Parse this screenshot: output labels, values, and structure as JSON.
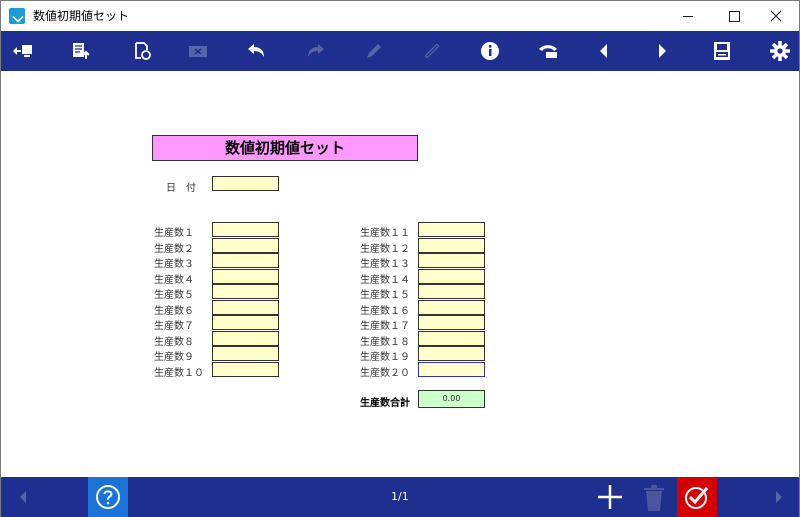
{
  "window": {
    "title": "数値初期値セット"
  },
  "toolbar": {
    "buttons": [
      {
        "name": "exit-icon",
        "enabled": true
      },
      {
        "name": "document-upload-icon",
        "enabled": true
      },
      {
        "name": "document-refresh-icon",
        "enabled": true
      },
      {
        "name": "clear-icon",
        "enabled": false
      },
      {
        "name": "undo-icon",
        "enabled": true
      },
      {
        "name": "redo-icon",
        "enabled": false
      },
      {
        "name": "pen-icon",
        "enabled": false
      },
      {
        "name": "link-icon",
        "enabled": false
      },
      {
        "name": "info-icon",
        "enabled": true
      },
      {
        "name": "phone-icon",
        "enabled": true
      },
      {
        "name": "prev-icon",
        "enabled": true
      },
      {
        "name": "next-icon",
        "enabled": true
      },
      {
        "name": "print-icon",
        "enabled": true
      },
      {
        "name": "gear-icon",
        "enabled": true
      }
    ]
  },
  "form": {
    "title": "数値初期値セット",
    "date_label": "日　付",
    "date_value": "",
    "left_fields": [
      {
        "label": "生産数１",
        "value": ""
      },
      {
        "label": "生産数２",
        "value": ""
      },
      {
        "label": "生産数３",
        "value": ""
      },
      {
        "label": "生産数４",
        "value": ""
      },
      {
        "label": "生産数５",
        "value": ""
      },
      {
        "label": "生産数６",
        "value": ""
      },
      {
        "label": "生産数７",
        "value": ""
      },
      {
        "label": "生産数８",
        "value": ""
      },
      {
        "label": "生産数９",
        "value": ""
      },
      {
        "label": "生産数１０",
        "value": ""
      }
    ],
    "right_fields": [
      {
        "label": "生産数１１",
        "value": ""
      },
      {
        "label": "生産数１２",
        "value": ""
      },
      {
        "label": "生産数１３",
        "value": ""
      },
      {
        "label": "生産数１４",
        "value": ""
      },
      {
        "label": "生産数１５",
        "value": ""
      },
      {
        "label": "生産数１６",
        "value": ""
      },
      {
        "label": "生産数１７",
        "value": ""
      },
      {
        "label": "生産数１８",
        "value": ""
      },
      {
        "label": "生産数１９",
        "value": ""
      },
      {
        "label": "生産数２０",
        "value": ""
      }
    ],
    "total_label": "生産数合計",
    "total_value": "0.00"
  },
  "bottombar": {
    "page": "1/1"
  },
  "colors": {
    "bar": "#1f2f8f",
    "title_fill": "#ff99ff",
    "field_fill": "#ffffcc",
    "total_fill": "#ccffcc",
    "help_bg": "#1a73d9",
    "confirm_bg": "#d40000"
  }
}
